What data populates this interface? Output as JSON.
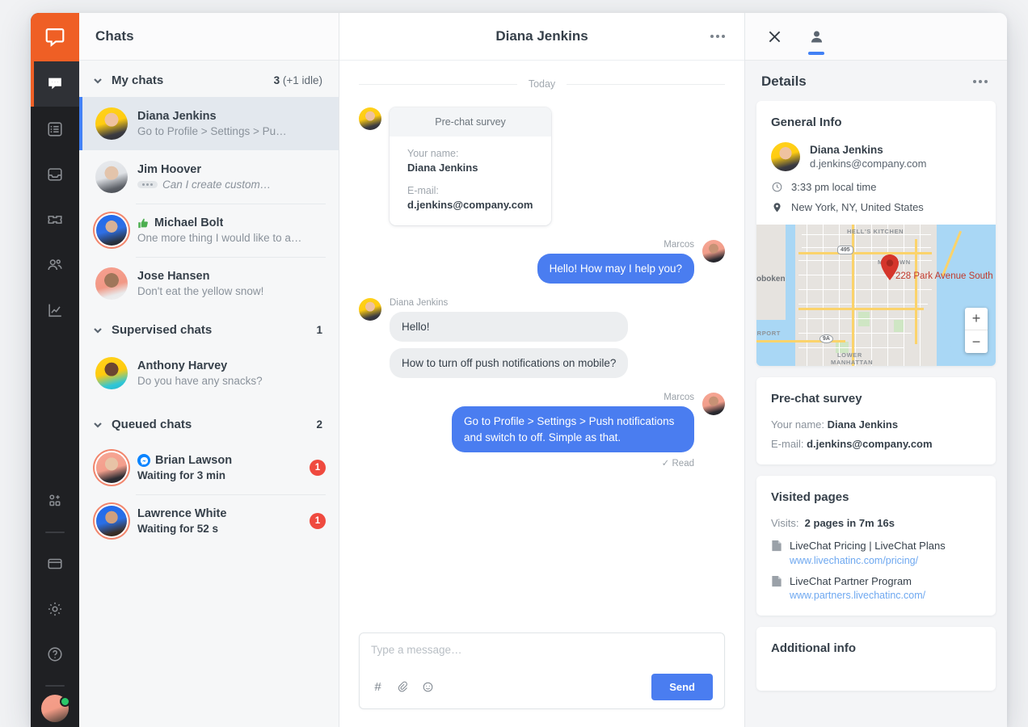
{
  "rail": {
    "logo": "livechat-logo",
    "items": [
      {
        "name": "chats",
        "icon": "chat-bubble-icon",
        "active": true
      },
      {
        "name": "archives",
        "icon": "list-icon",
        "active": false
      },
      {
        "name": "tickets-inbox",
        "icon": "inbox-icon",
        "active": false
      },
      {
        "name": "ticket",
        "icon": "ticket-icon",
        "active": false
      },
      {
        "name": "team",
        "icon": "team-icon",
        "active": false
      },
      {
        "name": "reports",
        "icon": "chart-line-icon",
        "active": false
      }
    ],
    "bottom_items": [
      {
        "name": "apps",
        "icon": "apps-add-icon"
      },
      {
        "name": "window",
        "icon": "browser-window-icon"
      },
      {
        "name": "settings",
        "icon": "gear-icon"
      },
      {
        "name": "help",
        "icon": "question-circle-icon"
      }
    ],
    "status": "online"
  },
  "chatlist": {
    "title": "Chats",
    "groups": [
      {
        "label": "My chats",
        "count": "3",
        "count_extra": " (+1 idle)",
        "rows": [
          {
            "name": "Diana Jenkins",
            "preview": "Go to Profile > Settings > Pu…",
            "avatar": "av-diana",
            "active": true,
            "ring": false,
            "badge": null,
            "typing": false,
            "rated": false,
            "messenger": false,
            "strong": false
          },
          {
            "name": "Jim Hoover",
            "preview": "Can I create custom…",
            "avatar": "av-jim",
            "active": false,
            "ring": false,
            "badge": null,
            "typing": true,
            "rated": false,
            "messenger": false,
            "strong": false
          },
          {
            "name": "Michael Bolt",
            "preview": "One more thing I would like to a…",
            "avatar": "av-michael",
            "active": false,
            "ring": true,
            "badge": null,
            "typing": false,
            "rated": true,
            "messenger": false,
            "strong": false
          },
          {
            "name": "Jose Hansen",
            "preview": "Don't eat the yellow snow!",
            "avatar": "av-jose",
            "active": false,
            "ring": false,
            "badge": null,
            "typing": false,
            "rated": false,
            "messenger": false,
            "strong": false
          }
        ]
      },
      {
        "label": "Supervised chats",
        "count": "1",
        "count_extra": "",
        "rows": [
          {
            "name": "Anthony Harvey",
            "preview": "Do you have any snacks?",
            "avatar": "av-anthony",
            "active": false,
            "ring": false,
            "badge": null,
            "typing": false,
            "rated": false,
            "messenger": false,
            "strong": false
          }
        ]
      },
      {
        "label": "Queued chats",
        "count": "2",
        "count_extra": "",
        "rows": [
          {
            "name": "Brian Lawson",
            "preview": "Waiting for 3 min",
            "avatar": "av-brian",
            "active": false,
            "ring": true,
            "badge": "1",
            "typing": false,
            "rated": false,
            "messenger": true,
            "strong": true
          },
          {
            "name": "Lawrence White",
            "preview": "Waiting for 52 s",
            "avatar": "av-lawrence",
            "active": false,
            "ring": true,
            "badge": "1",
            "typing": false,
            "rated": false,
            "messenger": false,
            "strong": true
          }
        ]
      }
    ]
  },
  "conversation": {
    "title": "Diana Jenkins",
    "day_label": "Today",
    "survey": {
      "header": "Pre-chat survey",
      "name_label": "Your name:",
      "name_value": "Diana Jenkins",
      "email_label": "E-mail:",
      "email_value": "d.jenkins@company.com"
    },
    "messages": [
      {
        "author": "Marcos",
        "text": "Hello! How may I help you?",
        "side": "out",
        "avatar": "av-marcos"
      },
      {
        "author": "Diana Jenkins",
        "text": "Hello!",
        "text2": "How to turn off push notifications on mobile?",
        "side": "in",
        "avatar": "av-diana"
      },
      {
        "author": "Marcos",
        "text": "Go to Profile > Settings > Push notifications and switch to off. Simple as that.",
        "side": "out",
        "avatar": "av-marcos"
      }
    ],
    "read_status": "✓ Read",
    "composer": {
      "placeholder": "Type a message…",
      "send_label": "Send",
      "icons": [
        "hash-icon",
        "paperclip-icon",
        "emoji-icon"
      ]
    }
  },
  "details": {
    "tabs": [
      {
        "name": "close",
        "icon": "close-icon",
        "active": false
      },
      {
        "name": "customer-details",
        "icon": "person-icon",
        "active": true
      }
    ],
    "heading": "Details",
    "general_info": {
      "title": "General Info",
      "name": "Diana Jenkins",
      "email": "d.jenkins@company.com",
      "local_time": "3:33 pm local time",
      "location": "New York, NY, United States"
    },
    "map": {
      "address": "228 Park Avenue South",
      "labels": [
        "HELL'S KITCHEN",
        "MIDTOWN",
        "oboken",
        "IRPORT",
        "LOWER MANHATTAN"
      ],
      "shields": [
        "495",
        "9A"
      ],
      "zoom_in": "+",
      "zoom_out": "−"
    },
    "pre_chat_survey": {
      "title": "Pre-chat survey",
      "name_label": "Your name:",
      "name_value": "Diana Jenkins",
      "email_label": "E-mail:",
      "email_value": "d.jenkins@company.com"
    },
    "visited_pages": {
      "title": "Visited pages",
      "visits_label": "Visits:",
      "visits_value": "2 pages in 7m 16s",
      "pages": [
        {
          "title": "LiveChat Pricing | LiveChat Plans",
          "url": "www.livechatinc.com/pricing/"
        },
        {
          "title": "LiveChat Partner Program",
          "url": "www.partners.livechatinc.com/"
        }
      ]
    },
    "additional_info": {
      "title": "Additional info"
    }
  },
  "colors": {
    "brand_orange": "#ef5f25",
    "accent_blue": "#4a7df0",
    "badge_red": "#ef4a3f",
    "rail_dark": "#1f2023",
    "online_green": "#2ac769"
  }
}
